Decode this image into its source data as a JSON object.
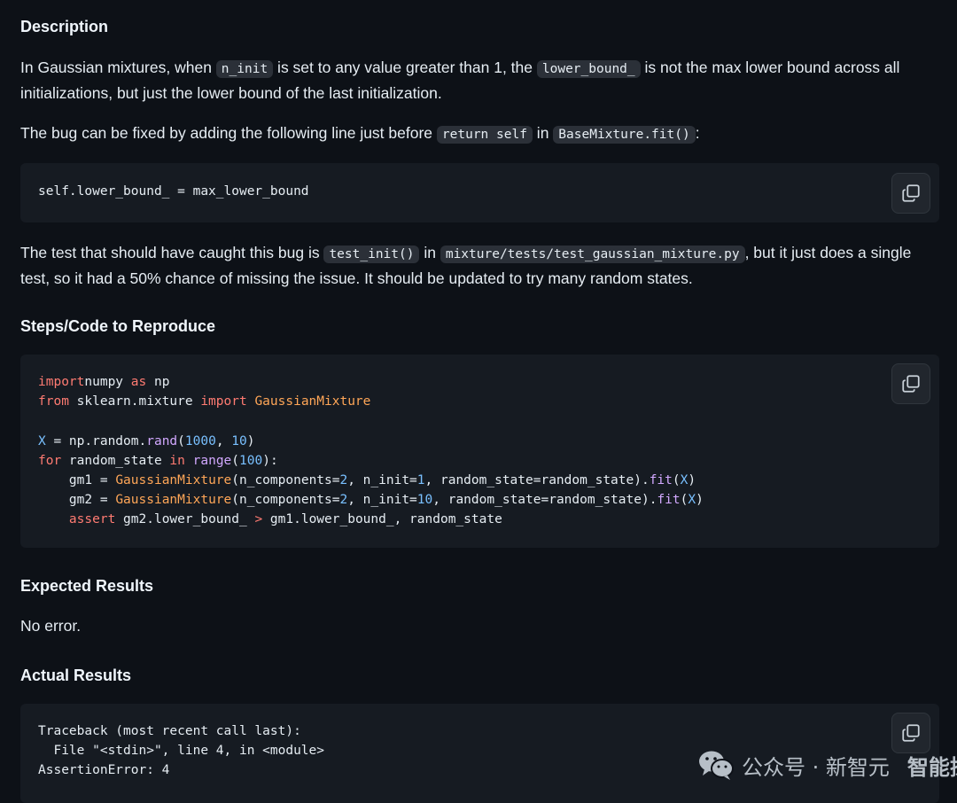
{
  "description": {
    "heading": "Description",
    "p1": {
      "t1": "In Gaussian mixtures, when ",
      "c1": "n_init",
      "t2": " is set to any value greater than 1, the ",
      "c2": "lower_bound_",
      "t3": " is not the max lower bound across all initializations, but just the lower bound of the last initialization."
    },
    "p2": {
      "t1": "The bug can be fixed by adding the following line just before ",
      "c1": "return self",
      "t2": " in ",
      "c2": "BaseMixture.fit()",
      "t3": ":"
    },
    "code": "self.lower_bound_ = max_lower_bound",
    "p3": {
      "t1": "The test that should have caught this bug is ",
      "c1": "test_init()",
      "t2": " in ",
      "c2": "mixture/tests/test_gaussian_mixture.py",
      "t3": ", but it just does a single test, so it had a 50% chance of missing the issue. It should be updated to try many random states."
    }
  },
  "steps": {
    "heading": "Steps/Code to Reproduce",
    "lines": [
      [
        [
          "kw",
          "import"
        ],
        [
          "",
          "numpy "
        ],
        [
          "kw",
          "as"
        ],
        [
          "",
          " np"
        ]
      ],
      [
        [
          "kw",
          "from"
        ],
        [
          "",
          " sklearn.mixture "
        ],
        [
          "kw",
          "import"
        ],
        [
          "cls",
          " GaussianMixture"
        ]
      ],
      [],
      [
        [
          "num",
          "X"
        ],
        [
          "",
          " = np.random."
        ],
        [
          "fn",
          "rand"
        ],
        [
          "",
          "("
        ],
        [
          "num",
          "1000"
        ],
        [
          "",
          ", "
        ],
        [
          "num",
          "10"
        ],
        [
          "",
          ")"
        ]
      ],
      [
        [
          "kw",
          "for"
        ],
        [
          "",
          " random_state "
        ],
        [
          "kw",
          "in"
        ],
        [
          "",
          " "
        ],
        [
          "fn",
          "range"
        ],
        [
          "",
          "("
        ],
        [
          "num",
          "100"
        ],
        [
          "",
          "):"
        ]
      ],
      [
        [
          "",
          "    gm1 = "
        ],
        [
          "cls",
          "GaussianMixture"
        ],
        [
          "",
          "(n_components="
        ],
        [
          "num",
          "2"
        ],
        [
          "",
          ", n_init="
        ],
        [
          "num",
          "1"
        ],
        [
          "",
          ", random_state=random_state)."
        ],
        [
          "fn",
          "fit"
        ],
        [
          "",
          "("
        ],
        [
          "num",
          "X"
        ],
        [
          "",
          ")"
        ]
      ],
      [
        [
          "",
          "    gm2 = "
        ],
        [
          "cls",
          "GaussianMixture"
        ],
        [
          "",
          "(n_components="
        ],
        [
          "num",
          "2"
        ],
        [
          "",
          ", n_init="
        ],
        [
          "num",
          "10"
        ],
        [
          "",
          ", random_state=random_state)."
        ],
        [
          "fn",
          "fit"
        ],
        [
          "",
          "("
        ],
        [
          "num",
          "X"
        ],
        [
          "",
          ")"
        ]
      ],
      [
        [
          "",
          "    "
        ],
        [
          "kw",
          "assert"
        ],
        [
          "",
          " gm2.lower_bound_ "
        ],
        [
          "kw",
          ">"
        ],
        [
          "",
          " gm1.lower_bound_, random_state"
        ]
      ]
    ]
  },
  "expected": {
    "heading": "Expected Results",
    "text": "No error."
  },
  "actual": {
    "heading": "Actual Results",
    "code": "Traceback (most recent call last):\n  File \"<stdin>\", line 4, in <module>\nAssertionError: 4"
  },
  "watermark": {
    "left": "公众号 · 新智元",
    "right": "智能探索"
  },
  "colors": {
    "background": "#0d1117",
    "code_background": "#161b22",
    "keyword": "#ff7b72",
    "function": "#d2a8ff",
    "class": "#ffa657",
    "number": "#79c0ff"
  },
  "icons": {
    "copy": "copy-icon",
    "wechat": "wechat-icon"
  }
}
